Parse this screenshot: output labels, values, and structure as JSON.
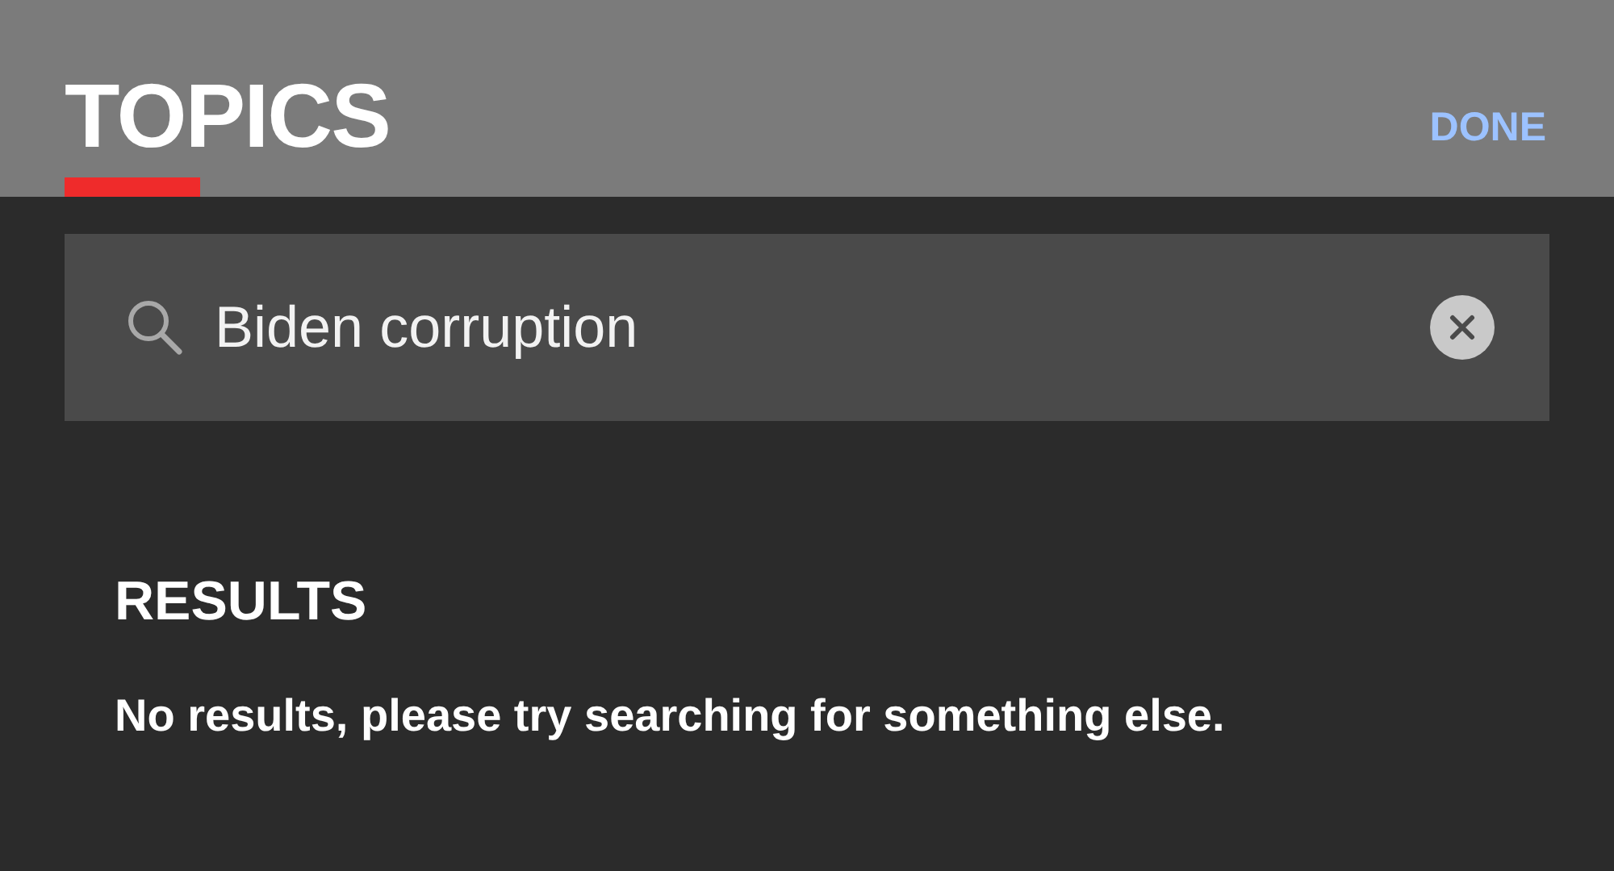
{
  "header": {
    "title": "TOPICS",
    "action": "DONE"
  },
  "search": {
    "value": "Biden corruption"
  },
  "results": {
    "heading": "RESULTS",
    "message": "No results, please try searching for something else."
  }
}
